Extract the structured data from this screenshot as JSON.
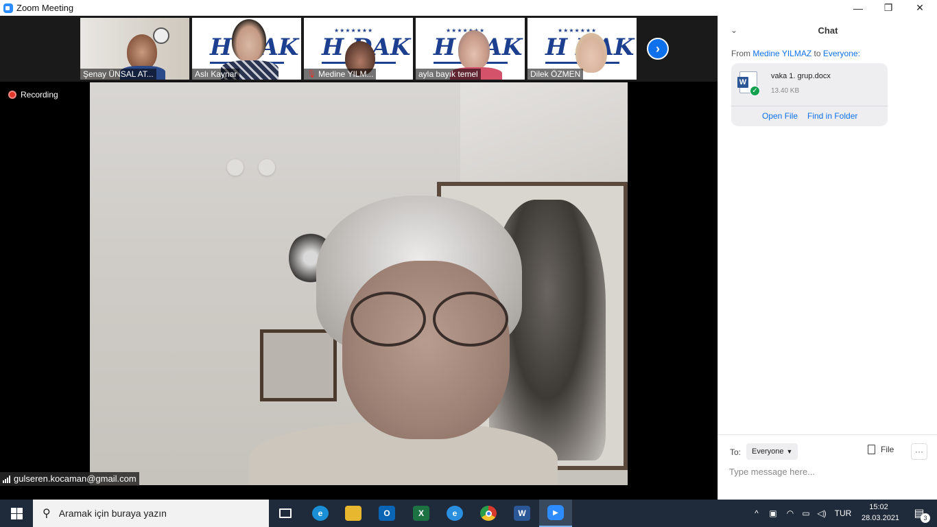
{
  "window": {
    "title": "Zoom Meeting"
  },
  "controls": {
    "minimize": "—",
    "restore": "❐",
    "close": "✕"
  },
  "thumbnails": [
    {
      "name": "Şenay ÜNSAL AT...",
      "muted": false
    },
    {
      "name": "Aslı Kaynar",
      "muted": false
    },
    {
      "name": "Medine YILM...",
      "muted": true
    },
    {
      "name": "ayla bayık temel",
      "muted": false
    },
    {
      "name": "Dilek ÖZMEN",
      "muted": false
    }
  ],
  "logo": {
    "text": "H    DAK",
    "stars": "★★★★★★★"
  },
  "next_arrow": "›",
  "recording": {
    "label": "Recording"
  },
  "speaker": {
    "name": "gulseren.kocaman@gmail.com"
  },
  "chat": {
    "title": "Chat",
    "collapse": "⌄",
    "from_label": "From",
    "sender": "Medine YILMAZ",
    "to_word": "to",
    "recipient": "Everyone:",
    "file": {
      "name": "vaka 1. grup.docx",
      "size": "13.40 KB",
      "open": "Open File",
      "find": "Find in Folder",
      "icon_letter": "W",
      "check": "✓"
    },
    "to_label": "To:",
    "to_value": "Everyone",
    "file_button": "File",
    "more": "···",
    "input_placeholder": "Type message here..."
  },
  "taskbar": {
    "search_placeholder": "Aramak için buraya yazın",
    "apps": [
      {
        "name": "task-view",
        "glyph": "▯",
        "color": "#1f2a3a"
      },
      {
        "name": "edge",
        "glyph": "e",
        "color": "#1a8fd6"
      },
      {
        "name": "file-explorer",
        "glyph": "▭",
        "color": "#e8b730"
      },
      {
        "name": "outlook",
        "glyph": "O",
        "color": "#0a64b4"
      },
      {
        "name": "excel",
        "glyph": "X",
        "color": "#1d7244"
      },
      {
        "name": "internet-explorer",
        "glyph": "e",
        "color": "#2b8fe0"
      },
      {
        "name": "chrome",
        "glyph": "◉",
        "color": "#d63a2f"
      },
      {
        "name": "word",
        "glyph": "W",
        "color": "#2b5797"
      },
      {
        "name": "zoom",
        "glyph": "▶",
        "color": "#2D8CFF"
      }
    ],
    "tray": {
      "chevron": "^",
      "lang": "TUR"
    },
    "clock": {
      "time": "15:02",
      "date": "28.03.2021"
    },
    "notifications": "3"
  }
}
